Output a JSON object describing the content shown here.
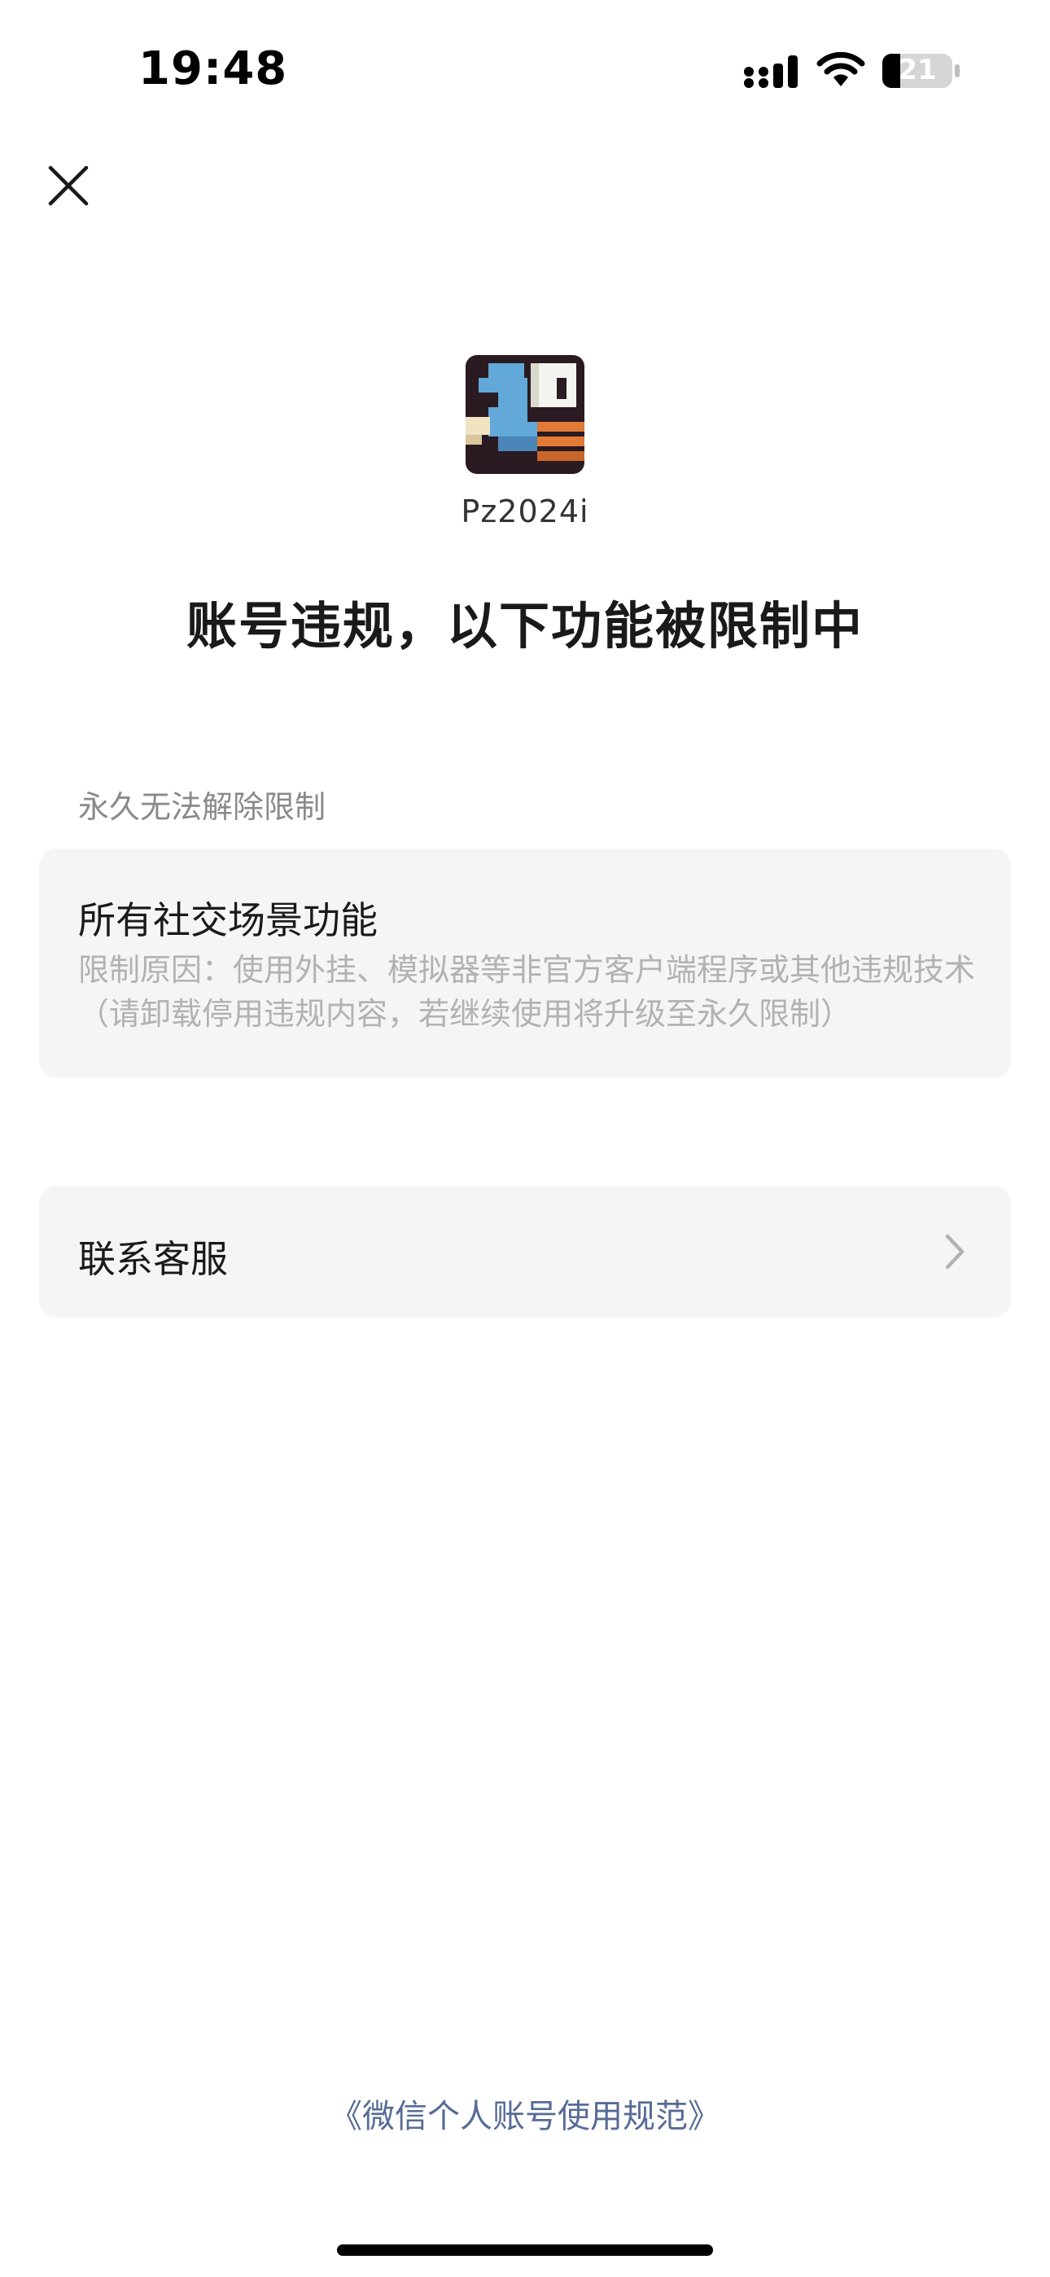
{
  "status_bar": {
    "time": "19:48",
    "battery_level": "21",
    "icons": [
      "signal-icon",
      "wifi-icon",
      "battery-icon"
    ]
  },
  "header": {
    "close_icon": "close-icon"
  },
  "profile": {
    "avatar": "pixel-bird-avatar",
    "username": "Pz2024i"
  },
  "headline": "账号违规，以下功能被限制中",
  "restriction": {
    "section_label": "永久无法解除限制",
    "title": "所有社交场景功能",
    "reason": "限制原因：使用外挂、模拟器等非官方客户端程序或其他违规技术（请卸载停用违规内容，若继续使用将升级至永久限制）"
  },
  "contact": {
    "label": "联系客服",
    "icon": "chevron-right-icon"
  },
  "footer": {
    "link_text": "《微信个人账号使用规范》"
  },
  "colors": {
    "link": "#576b95",
    "card_background": "#f5f5f5",
    "muted_text": "#b2b2b2"
  }
}
